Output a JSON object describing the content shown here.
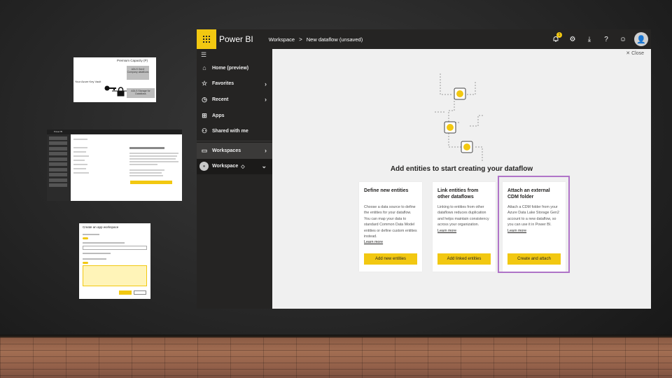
{
  "thumb1": {
    "title": "Premium Capacity (P)",
    "gray_box": "ADLS Gen2 Company dataflows",
    "left_text": "Your Azure Key Vault",
    "gray_box2": "ADLS Storage for Dataflows"
  },
  "thumb2": {
    "topbar": "Power BI"
  },
  "thumb3": {
    "title": "Create an app workspace"
  },
  "topbar": {
    "brand": "Power BI",
    "crumb_workspace": "Workspace",
    "crumb_sep": ">",
    "crumb_current": "New dataflow (unsaved)",
    "notification_count": "1"
  },
  "nav": {
    "items": [
      {
        "label": "Home (preview)",
        "icon": "home-icon"
      },
      {
        "label": "Favorites",
        "icon": "star-icon"
      },
      {
        "label": "Recent",
        "icon": "clock-icon"
      },
      {
        "label": "Apps",
        "icon": "apps-icon"
      },
      {
        "label": "Shared with me",
        "icon": "shared-icon"
      },
      {
        "label": "Workspaces",
        "icon": "workspaces-icon"
      },
      {
        "label": "Workspace",
        "icon": "workspace-avatar-icon"
      }
    ]
  },
  "content": {
    "close_label": "Close",
    "headline": "Add entities to start creating your dataflow",
    "cards": [
      {
        "title": "Define new entities",
        "desc": "Choose a data source to define the entities for your dataflow. You can map your data to standard Common Data Model entities or define custom entities instead.",
        "link": "Learn more",
        "button": "Add new entities"
      },
      {
        "title": "Link entities from other dataflows",
        "desc": "Linking to entities from other dataflows reduces duplication and helps maintain consistency across your organization.",
        "link": "Learn more",
        "button": "Add linked entities"
      },
      {
        "title": "Attach an external CDM folder",
        "desc": "Attach a CDM folder from your Azure Data Lake Storage Gen2 account to a new dataflow, so you can use it in Power BI.",
        "link": "Learn more",
        "button": "Create and attach"
      }
    ]
  },
  "colors": {
    "accent": "#f2c811",
    "nav_bg": "#252423",
    "highlight": "#b074c8"
  }
}
